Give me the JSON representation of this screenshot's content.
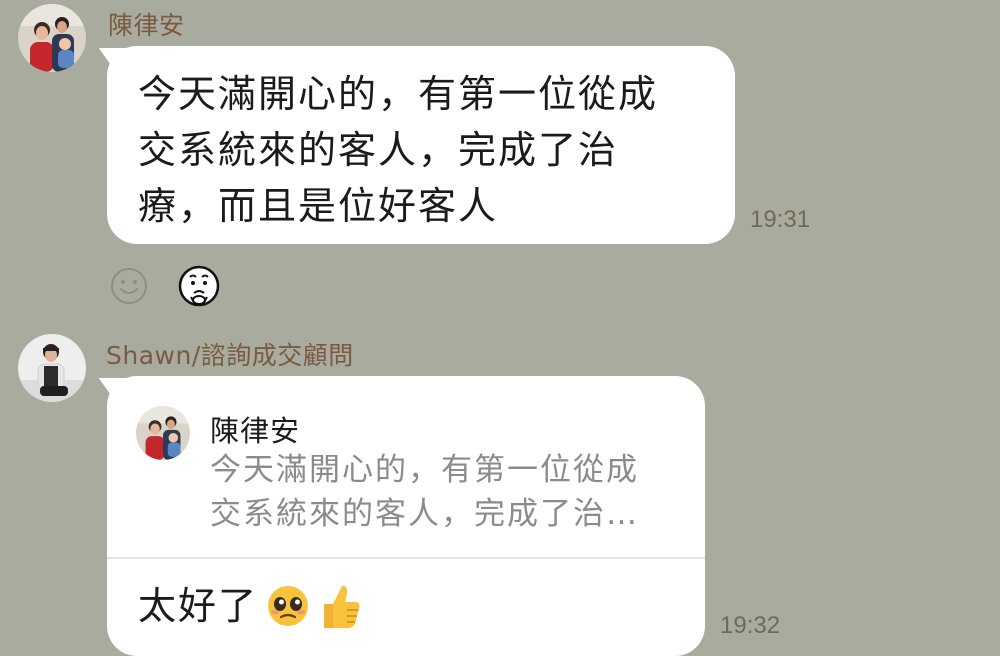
{
  "messages": [
    {
      "sender": "陳律安",
      "lines": [
        "今天滿開心的，有第一位從成",
        "交系統來的客人，完成了治",
        "療，而且是位好客人"
      ],
      "time": "19:31",
      "reactions": [
        "smiley-face-icon",
        "touched-face-sticker-icon"
      ]
    },
    {
      "sender": "Shawn/諮詢成交顧問",
      "reply_to": {
        "sender": "陳律安",
        "preview_lines": [
          "今天滿開心的，有第一位從成",
          "交系統來的客人，完成了治…"
        ]
      },
      "text": "太好了",
      "emojis": [
        "pleading-face-emoji-icon",
        "thumbs-up-emoji-icon"
      ],
      "time": "19:32"
    }
  ]
}
